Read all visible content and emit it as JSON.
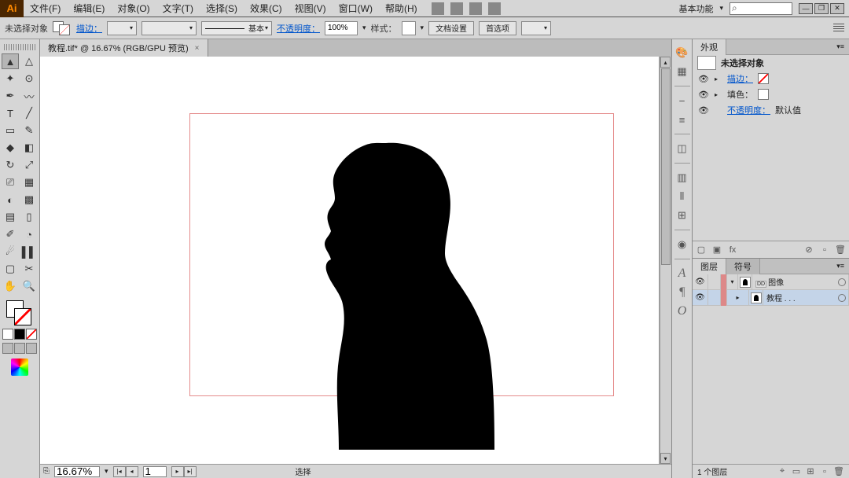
{
  "menubar": {
    "items": [
      "文件(F)",
      "编辑(E)",
      "对象(O)",
      "文字(T)",
      "选择(S)",
      "效果(C)",
      "视图(V)",
      "窗口(W)",
      "帮助(H)"
    ],
    "workspace": "基本功能",
    "search_placeholder": ""
  },
  "controlbar": {
    "selection_label": "未选择对象",
    "stroke_label": "描边：",
    "stroke_style_label": "基本",
    "opacity_label": "不透明度：",
    "opacity_value": "100%",
    "style_label": "样式：",
    "doc_setup": "文档设置",
    "preferences": "首选项"
  },
  "document": {
    "tab_title": "教程.tif* @ 16.67% (RGB/GPU 预览)"
  },
  "status": {
    "zoom": "16.67%",
    "page_current": "1",
    "label": "选择"
  },
  "appearance_panel": {
    "tab": "外观",
    "no_selection": "未选择对象",
    "stroke": "描边：",
    "fill": "填色：",
    "opacity_label": "不透明度：",
    "opacity_value": "默认值"
  },
  "layers_panel": {
    "tabs": [
      "图层",
      "符号"
    ],
    "rows": [
      {
        "name": "图像",
        "expanded": true,
        "sublayer": false
      },
      {
        "name": "教程 . . .",
        "expanded": false,
        "sublayer": true
      }
    ],
    "footer": "1 个图层"
  },
  "dock_letters": [
    "A",
    "¶",
    "O"
  ],
  "colors": {
    "artboard_border": "#e58b8b",
    "link": "#0055cc"
  }
}
